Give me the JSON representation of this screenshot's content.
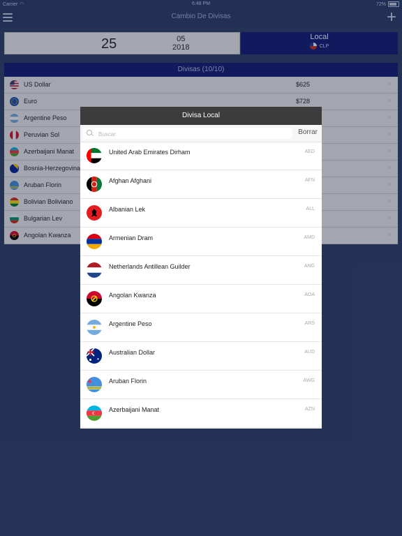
{
  "status_bar": {
    "carrier": "Carrier",
    "time": "6:48 PM",
    "battery": "72%"
  },
  "navbar": {
    "title": "Cambio De Divisas"
  },
  "date_panel": {
    "day": "25",
    "month": "05",
    "year": "2018"
  },
  "local_panel": {
    "label": "Local",
    "currency_code": "CLP"
  },
  "list_header": "Divisas (10/10)",
  "currency_rows": [
    {
      "name": "US Dollar",
      "value": "$625",
      "flag": "us"
    },
    {
      "name": "Euro",
      "value": "$728",
      "flag": "eu"
    },
    {
      "name": "Argentine Peso",
      "value": "",
      "flag": "ar"
    },
    {
      "name": "Peruvian Sol",
      "value": "",
      "flag": "pe"
    },
    {
      "name": "Azerbaijani Manat",
      "value": "",
      "flag": "az"
    },
    {
      "name": "Bosnia-Herzegovina",
      "value": "",
      "flag": "ba"
    },
    {
      "name": "Aruban Florin",
      "value": "",
      "flag": "aw"
    },
    {
      "name": "Bolivian Boliviano",
      "value": "",
      "flag": "bo"
    },
    {
      "name": "Bulgarian Lev",
      "value": "",
      "flag": "bg"
    },
    {
      "name": "Angolan Kwanza",
      "value": "",
      "flag": "ao"
    }
  ],
  "modal": {
    "title": "Divisa Local",
    "search_placeholder": "Buscar",
    "clear_label": "Borrar",
    "items": [
      {
        "name": "United Arab Emirates Dirham",
        "code": "AED",
        "flag": "ae"
      },
      {
        "name": "Afghan Afghani",
        "code": "AFN",
        "flag": "af"
      },
      {
        "name": "Albanian Lek",
        "code": "ALL",
        "flag": "al"
      },
      {
        "name": "Armenian Dram",
        "code": "AMD",
        "flag": "am"
      },
      {
        "name": "Netherlands Antillean Guilder",
        "code": "ANG",
        "flag": "an"
      },
      {
        "name": "Angolan Kwanza",
        "code": "AOA",
        "flag": "ao"
      },
      {
        "name": "Argentine Peso",
        "code": "ARS",
        "flag": "ar"
      },
      {
        "name": "Australian Dollar",
        "code": "AUD",
        "flag": "au"
      },
      {
        "name": "Aruban Florin",
        "code": "AWG",
        "flag": "aw"
      },
      {
        "name": "Azerbaijani Manat",
        "code": "AZN",
        "flag": "az"
      }
    ]
  },
  "colors": {
    "background": "#2d3f66",
    "navbar": "#2a3b66",
    "accent_navy": "#0e1a70",
    "modal_header": "#3c3c3c"
  }
}
